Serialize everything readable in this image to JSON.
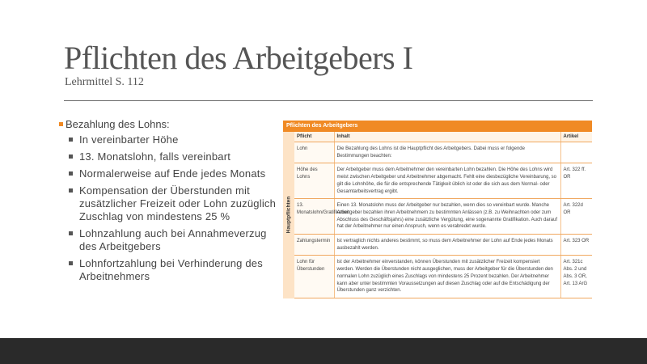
{
  "slide": {
    "title": "Pflichten des Arbeitgebers I",
    "subtitle": "Lehrmittel S. 112",
    "main_bullet": "Bezahlung des Lohns:",
    "sub_bullets": [
      "In vereinbarter Höhe",
      "13. Monatslohn, falls vereinbart",
      "Normalerweise auf Ende jedes Monats",
      "Kompensation der Überstunden mit zusätzlicher Freizeit oder Lohn zuzüglich Zuschlag von mindestens 25 %",
      "Lohnzahlung auch bei Annahmeverzug des Arbeitgebers",
      "Lohnfortzahlung bei Verhinderung des Arbeitnehmers"
    ]
  },
  "table": {
    "heading": "Pflichten des Arbeitgebers",
    "side_label": "Hauptpflichten",
    "columns": [
      "Pflicht",
      "Inhalt",
      "Artikel"
    ],
    "rows": [
      {
        "pflicht": "Lohn",
        "inhalt": "Die Bezahlung des Lohns ist die Hauptpflicht des Arbeitgebers. Dabei muss er folgende Bestimmungen beachten:",
        "artikel": ""
      },
      {
        "pflicht": "Höhe des Lohns",
        "inhalt": "Der Arbeitgeber muss dem Arbeitnehmer den vereinbarten Lohn bezahlen. Die Höhe des Lohns wird meist zwischen Arbeitgeber und Arbeitnehmer abgemacht. Fehlt eine diesbezügliche Vereinbarung, so gilt die Lohnhöhe, die für die entsprechende Tätigkeit üblich ist oder die sich aus dem Normal- oder Gesamtarbeitsvertrag ergibt.",
        "artikel": "Art. 322 ff. OR"
      },
      {
        "pflicht": "13. Monatslohn/Gratifikation",
        "inhalt": "Einen 13. Monatslohn muss der Arbeitgeber nur bezahlen, wenn dies so vereinbart wurde. Manche Arbeitgeber bezahlen ihren Arbeitnehmern zu bestimmten Anlässen (z.B. zu Weihnachten oder zum Abschluss des Geschäftsjahrs) eine zusätzliche Vergütung, eine sogenannte Gratifikation. Auch darauf hat der Arbeitnehmer nur einen Anspruch, wenn es verabredet wurde.",
        "artikel": "Art. 322d OR"
      },
      {
        "pflicht": "Zahlungstermin",
        "inhalt": "Ist vertraglich nichts anderes bestimmt, so muss dem Arbeitnehmer der Lohn auf Ende jedes Monats ausbezahlt werden.",
        "artikel": "Art. 323 OR"
      },
      {
        "pflicht": "Lohn für Überstunden",
        "inhalt": "Ist der Arbeitnehmer einverstanden, können Überstunden mit zusätzlicher Freizeit kompensiert werden. Werden die Überstunden nicht ausgeglichen, muss der Arbeitgeber für die Überstunden den normalen Lohn zuzüglich eines Zuschlags von mindestens 25 Prozent bezahlen. Der Arbeitnehmer kann aber unter bestimmten Voraussetzungen auf diesen Zuschlag oder auf die Entschädigung der Überstunden ganz verzichten.",
        "artikel": "Art. 321c Abs. 2 und Abs. 3 OR, Art. 13 ArG"
      }
    ]
  },
  "colors": {
    "accent": "#f08a24",
    "side_fill": "#fde3c6",
    "footer": "#2a2a2a"
  }
}
